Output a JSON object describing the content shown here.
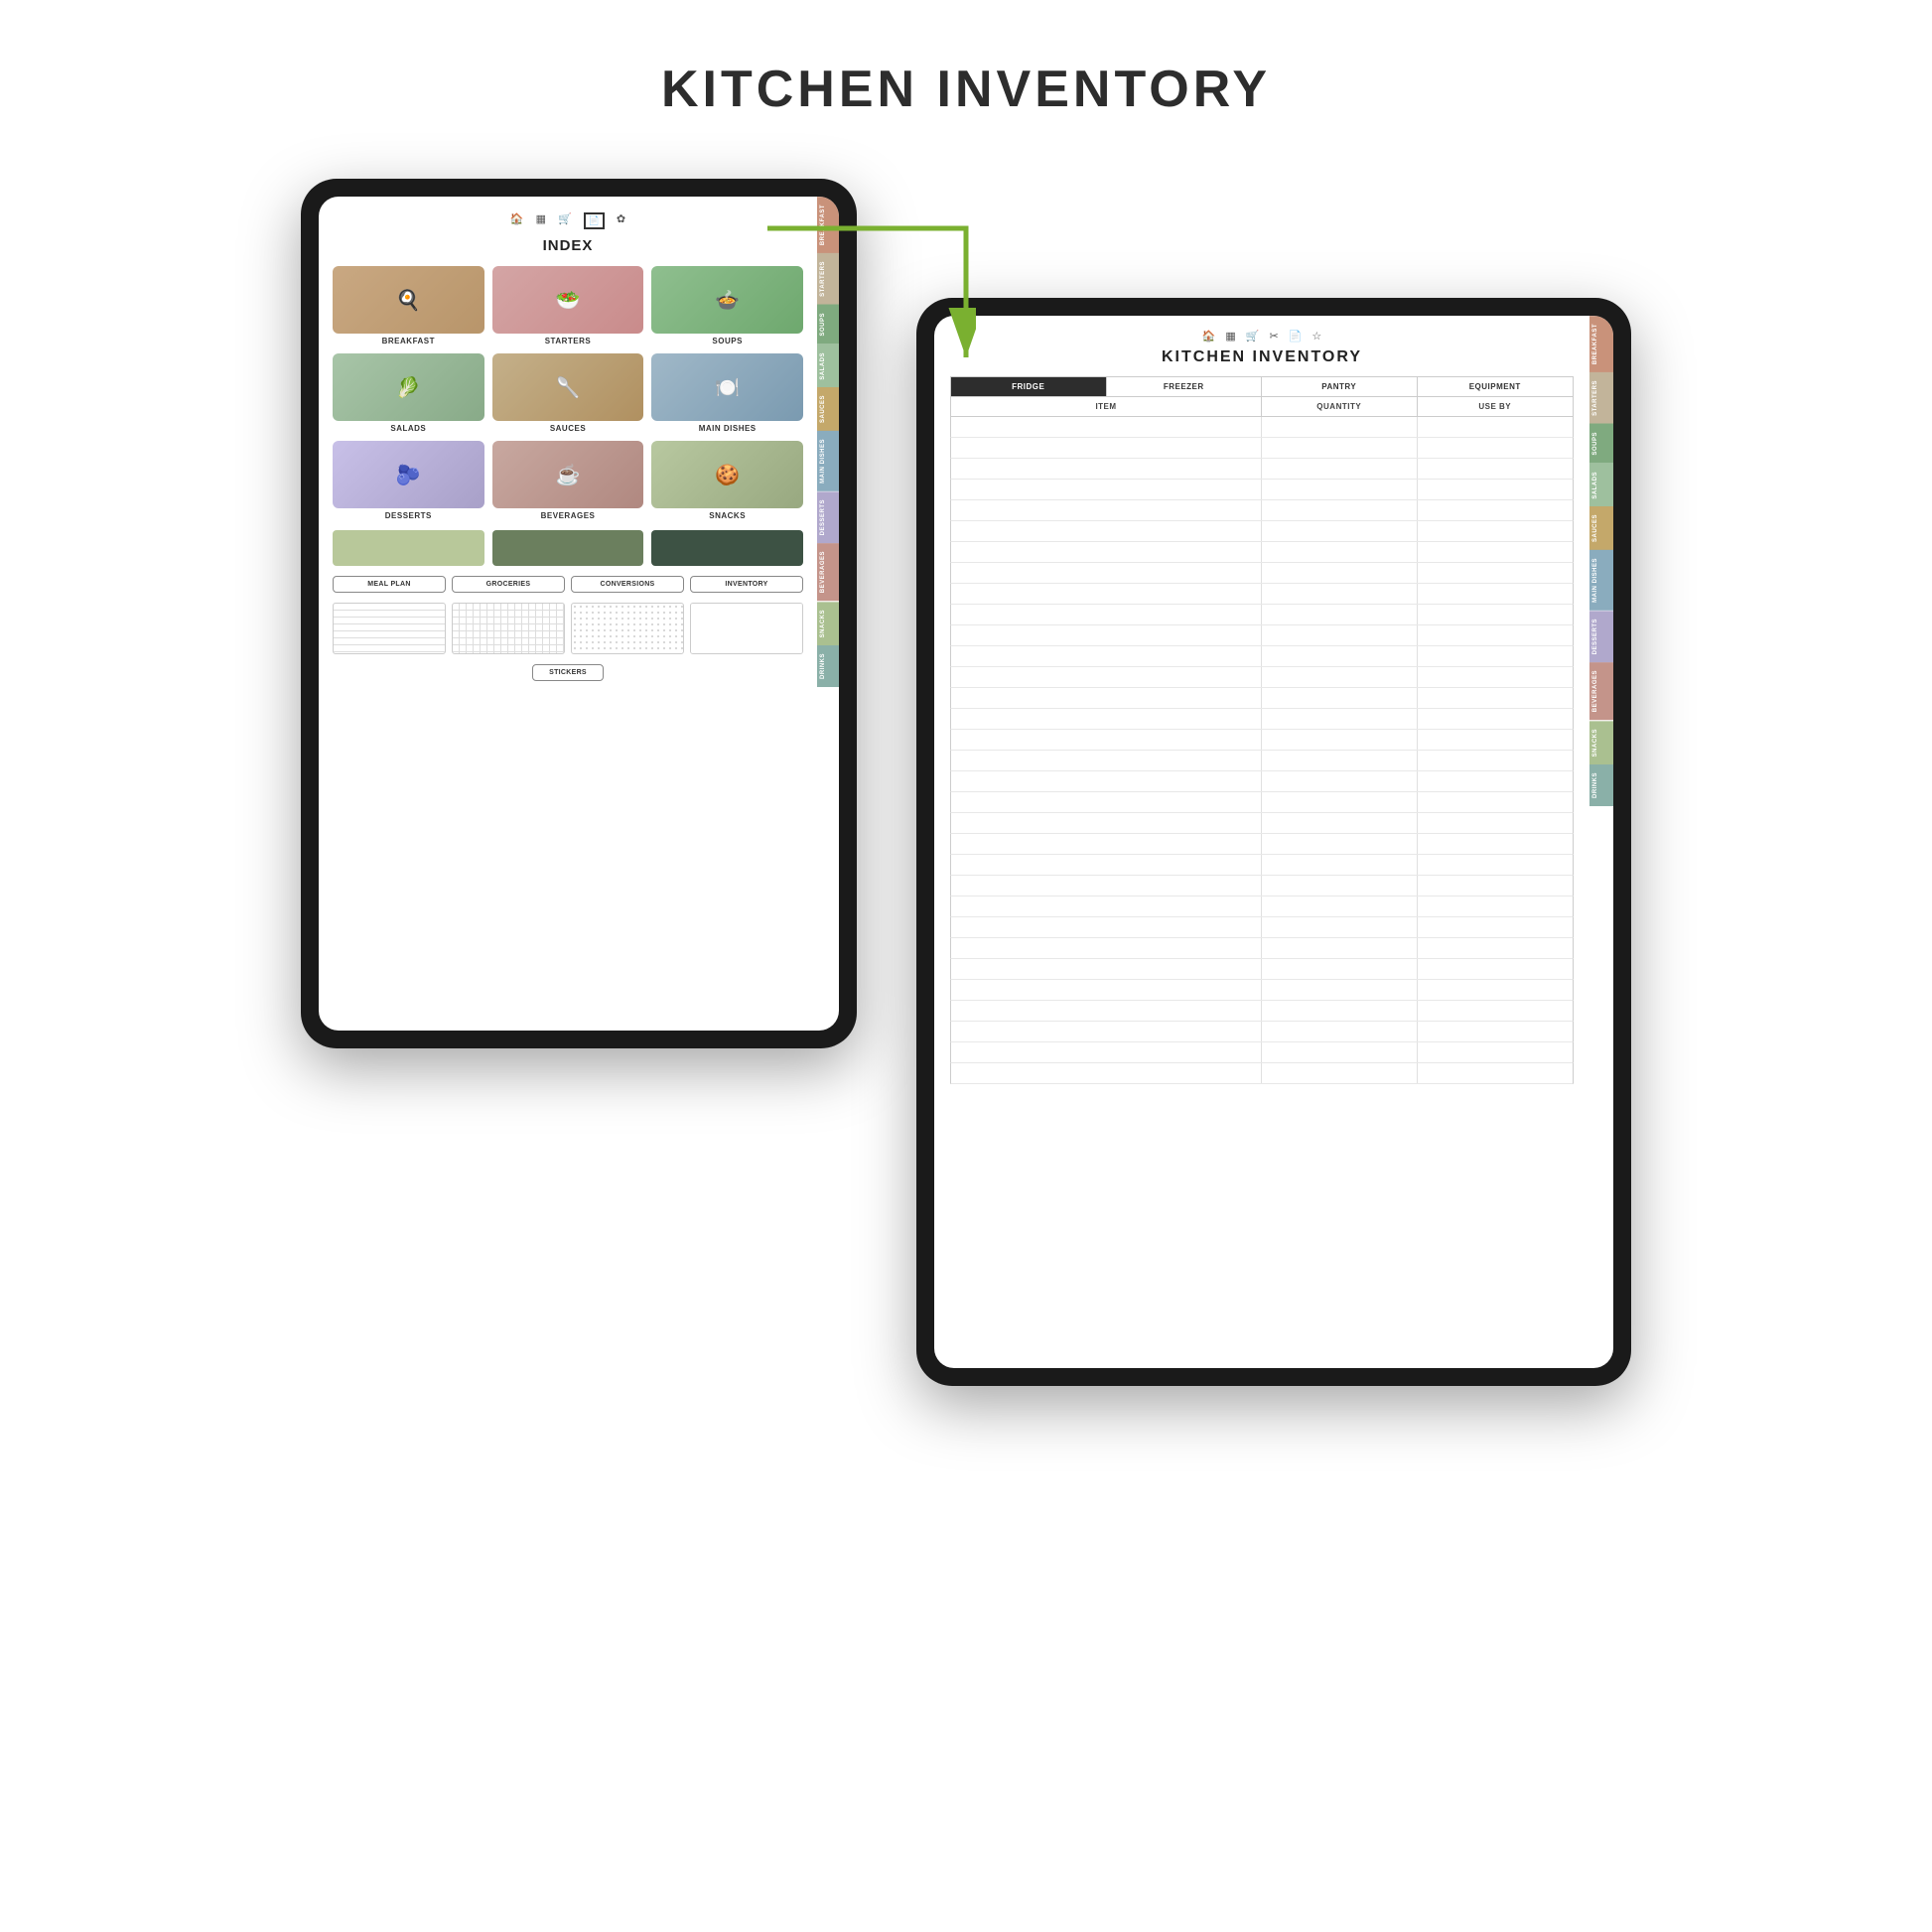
{
  "page": {
    "title": "KITCHEN INVENTORY"
  },
  "left_tablet": {
    "top_icons": [
      "🏠",
      "▦",
      "🛒",
      "⬛",
      "📄",
      "✿"
    ],
    "index_title": "INDEX",
    "food_items": [
      {
        "label": "BREAKFAST",
        "color": "breakfast-bg"
      },
      {
        "label": "STARTERS",
        "color": "starters-bg"
      },
      {
        "label": "SOUPS",
        "color": "soups-bg"
      },
      {
        "label": "SALADS",
        "color": "salads-bg"
      },
      {
        "label": "SAUCES",
        "color": "sauces-bg"
      },
      {
        "label": "MAIN DISHES",
        "color": "main-bg"
      },
      {
        "label": "DESSERTS",
        "color": "desserts-bg"
      },
      {
        "label": "BEVERAGES",
        "color": "beverages-bg"
      },
      {
        "label": "SNACKS",
        "color": "snacks-bg"
      }
    ],
    "color_blocks": [
      {
        "color": "#b8c89a"
      },
      {
        "color": "#6b7f5e"
      },
      {
        "color": "#3d5244"
      }
    ],
    "nav_buttons": [
      "MEAL PLAN",
      "GROCERIES",
      "CONVERSIONS",
      "INVENTORY"
    ],
    "stickers_label": "STICKERS",
    "sidebar_tabs": [
      {
        "label": "BREAKFAST",
        "color": "#c9927a"
      },
      {
        "label": "STARTERS",
        "color": "#c2b49a"
      },
      {
        "label": "SOUPS",
        "color": "#7faa7f"
      },
      {
        "label": "SALADS",
        "color": "#9ec09e"
      },
      {
        "label": "SAUCES",
        "color": "#c4a86a"
      },
      {
        "label": "MAIN DISHES",
        "color": "#8aacbe"
      },
      {
        "label": "DESSERTS",
        "color": "#b0a8cc"
      },
      {
        "label": "BEVERAGES",
        "color": "#c4948a"
      },
      {
        "label": "SNACKS",
        "color": "#aac090"
      },
      {
        "label": "DRINKS",
        "color": "#8ab0a8"
      }
    ]
  },
  "right_tablet": {
    "top_icons": [
      "🏠",
      "▦",
      "🛒",
      "✂",
      "📄",
      "☆"
    ],
    "title": "KITCHEN INVENTORY",
    "tabs": [
      "FRIDGE",
      "FREEZER",
      "PANTRY",
      "EQUIPMENT"
    ],
    "active_tab": "FRIDGE",
    "columns": [
      "ITEM",
      "QUANTITY",
      "USE BY"
    ],
    "sidebar_tabs": [
      {
        "label": "BREAKFAST",
        "color": "#c9927a"
      },
      {
        "label": "STARTERS",
        "color": "#c2b49a"
      },
      {
        "label": "SOUPS",
        "color": "#7faa7f"
      },
      {
        "label": "SALADS",
        "color": "#9ec09e"
      },
      {
        "label": "SAUCES",
        "color": "#c4a86a"
      },
      {
        "label": "MAIN DISHES",
        "color": "#8aacbe"
      },
      {
        "label": "DESSERTS",
        "color": "#b0a8cc"
      },
      {
        "label": "BEVERAGES",
        "color": "#c4948a"
      },
      {
        "label": "SNACKS",
        "color": "#aac090"
      },
      {
        "label": "DRINKS",
        "color": "#8ab0a8"
      }
    ],
    "row_count": 32
  },
  "arrow": {
    "color": "#7ab030"
  }
}
